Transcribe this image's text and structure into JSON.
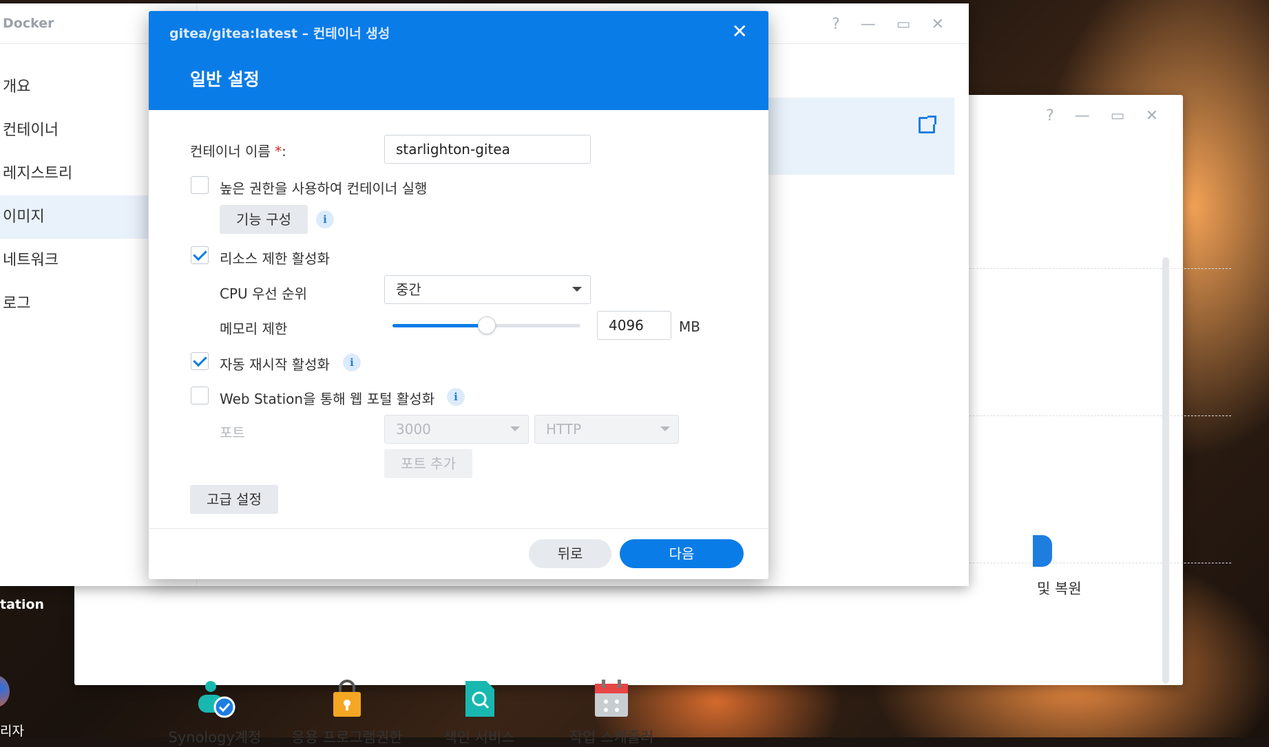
{
  "control_panel": {
    "window_controls": {
      "help": "?",
      "minimize": "—",
      "maximize": "▭",
      "close": "✕"
    },
    "backup_label": "및 복원",
    "apps": [
      {
        "label": "Synology계정",
        "icon": "user-check-icon"
      },
      {
        "label": "응용 프로그램권한",
        "icon": "lock-icon"
      },
      {
        "label": "색인 서비스",
        "icon": "search-doc-icon"
      },
      {
        "label": "작업 스케줄러",
        "icon": "calendar-icon"
      }
    ]
  },
  "docker": {
    "title": "Docker",
    "window_controls": {
      "help": "?",
      "minimize": "—",
      "maximize": "▭",
      "close": "✕"
    },
    "sidebar": [
      {
        "label": "개요",
        "active": false
      },
      {
        "label": "컨테이너",
        "active": false
      },
      {
        "label": "레지스트리",
        "active": false
      },
      {
        "label": "이미지",
        "active": true
      },
      {
        "label": "네트워크",
        "active": false
      },
      {
        "label": "로그",
        "active": false
      }
    ]
  },
  "desktop": {
    "label_top": "tation",
    "label_bottom": "리자"
  },
  "dialog": {
    "window_title": "gitea/gitea:latest – 컨테이너 생성",
    "close": "✕",
    "step_title": "일반 설정",
    "container_name_label": "컨테이너 이름 ",
    "required_mark": "*",
    "colon": ":",
    "container_name_value": "starlighton-gitea",
    "privileged_label": "높은 권한을 사용하여 컨테이너 실행",
    "privileged_checked": false,
    "capabilities_button": "기능 구성",
    "resource_limit_label": "리소스 제한 활성화",
    "resource_limit_checked": true,
    "cpu_priority_label": "CPU 우선 순위",
    "cpu_priority_value": "중간",
    "memory_limit_label": "메모리 제한",
    "memory_value": "4096",
    "memory_unit": "MB",
    "memory_slider_fraction": 0.5,
    "auto_restart_label": "자동 재시작 활성화",
    "auto_restart_checked": true,
    "web_portal_label": "Web Station을 통해 웹 포털 활성화",
    "web_portal_checked": false,
    "port_label": "포트",
    "port_value": "3000",
    "protocol_value": "HTTP",
    "add_port_button": "포트 추가",
    "advanced_button": "고급 설정",
    "back_button": "뒤로",
    "next_button": "다음",
    "info_glyph": "i",
    "accent_color": "#0a7ce8"
  }
}
